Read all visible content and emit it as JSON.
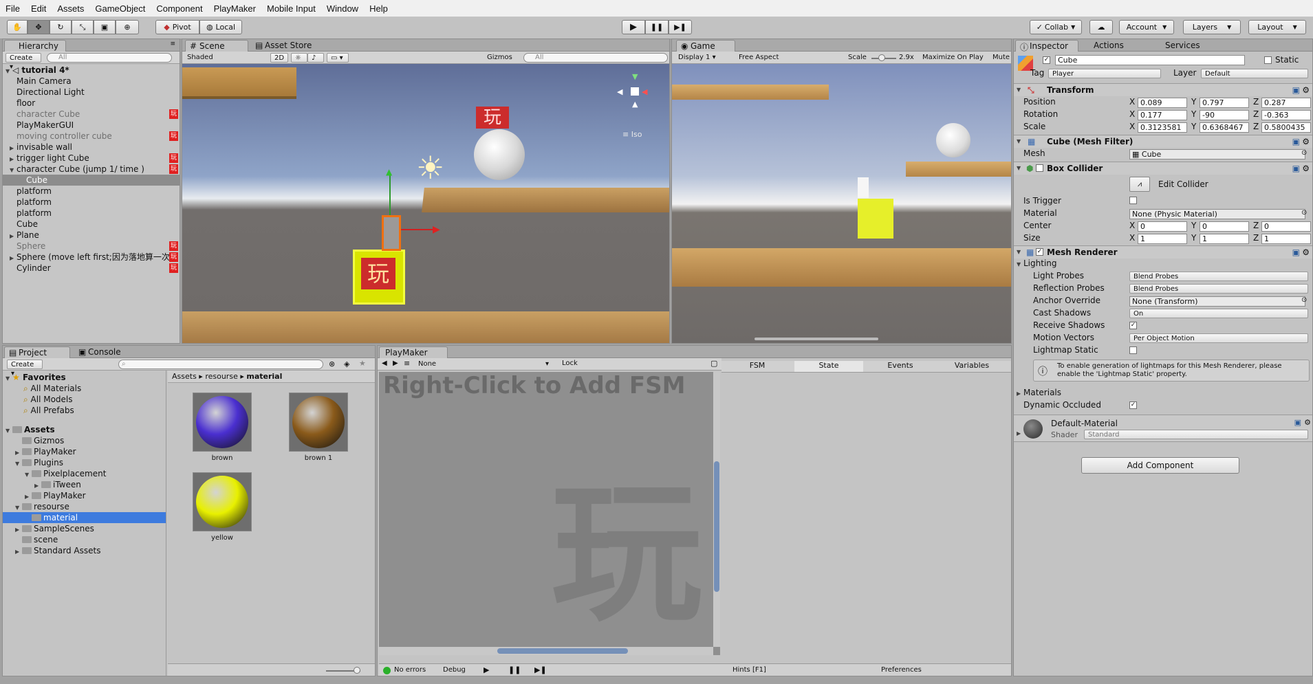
{
  "menu": [
    "File",
    "Edit",
    "Assets",
    "GameObject",
    "Component",
    "PlayMaker",
    "Mobile Input",
    "Window",
    "Help"
  ],
  "toolbar": {
    "pivot": "Pivot",
    "local": "Local",
    "collab": "Collab",
    "account": "Account",
    "layers": "Layers",
    "layout": "Layout"
  },
  "hierarchy": {
    "tab": "Hierarchy",
    "create": "Create",
    "search": "All",
    "scene": "tutorial 4*",
    "items": [
      {
        "label": "Main Camera",
        "indent": 1
      },
      {
        "label": "Directional Light",
        "indent": 1
      },
      {
        "label": "floor",
        "indent": 1
      },
      {
        "label": "character Cube",
        "indent": 1,
        "dim": true,
        "badge": "玩"
      },
      {
        "label": "PlayMakerGUI",
        "indent": 1
      },
      {
        "label": "moving controller cube",
        "indent": 1,
        "dim": true,
        "badge": "玩"
      },
      {
        "label": "invisable wall",
        "indent": 1,
        "arrow": "right"
      },
      {
        "label": "trigger light Cube",
        "indent": 1,
        "arrow": "right",
        "badge": "玩"
      },
      {
        "label": "character Cube (jump 1/ time )",
        "indent": 1,
        "arrow": "down",
        "badge": "玩"
      },
      {
        "label": "Cube",
        "indent": 2,
        "selected": true
      },
      {
        "label": "platform",
        "indent": 1
      },
      {
        "label": "platform",
        "indent": 1
      },
      {
        "label": "platform",
        "indent": 1
      },
      {
        "label": "Cube",
        "indent": 1
      },
      {
        "label": "Plane",
        "indent": 1,
        "arrow": "right"
      },
      {
        "label": "Sphere",
        "indent": 1,
        "dim": true,
        "badge": "玩"
      },
      {
        "label": "Sphere (move left first;因为落地算一次",
        "indent": 1,
        "arrow": "right",
        "badge": "玩"
      },
      {
        "label": "Cylinder",
        "indent": 1,
        "badge": "玩"
      }
    ]
  },
  "scene": {
    "tab": "Scene",
    "tab2": "Asset Store",
    "shading": "Shaded",
    "mode2d": "2D",
    "gizmos": "Gizmos",
    "search": "All",
    "iso": "Iso",
    "badge": "玩"
  },
  "game": {
    "tab": "Game",
    "display": "Display 1",
    "aspect": "Free Aspect",
    "scale_label": "Scale",
    "scale": "2.9x",
    "maximize": "Maximize On Play",
    "mute": "Mute"
  },
  "inspector": {
    "tab": "Inspector",
    "tab2": "Actions",
    "tab3": "Services",
    "name": "Cube",
    "static": "Static",
    "tag_label": "Tag",
    "tag": "Player",
    "layer_label": "Layer",
    "layer": "Default",
    "transform": {
      "title": "Transform",
      "rows": [
        {
          "label": "Position",
          "x": "0.089",
          "y": "0.797",
          "z": "0.287"
        },
        {
          "label": "Rotation",
          "x": "0.177",
          "y": "-90",
          "z": "-0.363"
        },
        {
          "label": "Scale",
          "x": "0.3123581",
          "y": "0.6368467",
          "z": "0.5800435"
        }
      ]
    },
    "mesh_filter": {
      "title": "Cube (Mesh Filter)",
      "mesh_label": "Mesh",
      "mesh": "Cube"
    },
    "box_collider": {
      "title": "Box Collider",
      "edit": "Edit Collider",
      "trigger_label": "Is Trigger",
      "material_label": "Material",
      "material": "None (Physic Material)",
      "center_label": "Center",
      "center": [
        "0",
        "0",
        "0"
      ],
      "size_label": "Size",
      "size": [
        "1",
        "1",
        "1"
      ]
    },
    "mesh_renderer": {
      "title": "Mesh Renderer",
      "lighting": "Lighting",
      "light_probes_label": "Light Probes",
      "light_probes": "Blend Probes",
      "reflection_label": "Reflection Probes",
      "reflection": "Blend Probes",
      "anchor_label": "Anchor Override",
      "anchor": "None (Transform)",
      "cast_label": "Cast Shadows",
      "cast": "On",
      "receive_label": "Receive Shadows",
      "motion_label": "Motion Vectors",
      "motion": "Per Object Motion",
      "lightmap_label": "Lightmap Static",
      "info": "To enable generation of lightmaps for this Mesh Renderer, please enable the 'Lightmap Static' property.",
      "materials": "Materials",
      "dynamic_label": "Dynamic Occluded"
    },
    "material": {
      "name": "Default-Material",
      "shader_label": "Shader",
      "shader": "Standard"
    },
    "add_component": "Add Component"
  },
  "project": {
    "tab": "Project",
    "tab2": "Console",
    "create": "Create",
    "favorites": "Favorites",
    "fav_items": [
      "All Materials",
      "All Models",
      "All Prefabs"
    ],
    "assets": "Assets",
    "tree": [
      {
        "label": "Gizmos",
        "indent": 1
      },
      {
        "label": "PlayMaker",
        "indent": 1,
        "arrow": "right"
      },
      {
        "label": "Plugins",
        "indent": 1,
        "arrow": "down"
      },
      {
        "label": "Pixelplacement",
        "indent": 2,
        "arrow": "down"
      },
      {
        "label": "iTween",
        "indent": 3,
        "arrow": "right"
      },
      {
        "label": "PlayMaker",
        "indent": 2,
        "arrow": "right"
      },
      {
        "label": "resourse",
        "indent": 1,
        "arrow": "down"
      },
      {
        "label": "material",
        "indent": 2,
        "selected": true
      },
      {
        "label": "SampleScenes",
        "indent": 1,
        "arrow": "right"
      },
      {
        "label": "scene",
        "indent": 1
      },
      {
        "label": "Standard Assets",
        "indent": 1,
        "arrow": "right"
      }
    ],
    "breadcrumb": [
      "Assets",
      "resourse",
      "material"
    ],
    "materials": [
      {
        "name": "brown",
        "color": "#4a2fd0"
      },
      {
        "name": "brown 1",
        "color": "#8a5a1a"
      },
      {
        "name": "yellow",
        "color": "#e8f000"
      }
    ]
  },
  "playmaker": {
    "tab": "PlayMaker",
    "fsm_select": "None",
    "lock": "Lock",
    "hint": "Right-Click to Add FSM",
    "watermark": "玩",
    "tabs": [
      "FSM",
      "State",
      "Events",
      "Variables"
    ],
    "status": "No errors",
    "debug": "Debug",
    "hints": "Hints [F1]",
    "preferences": "Preferences"
  }
}
